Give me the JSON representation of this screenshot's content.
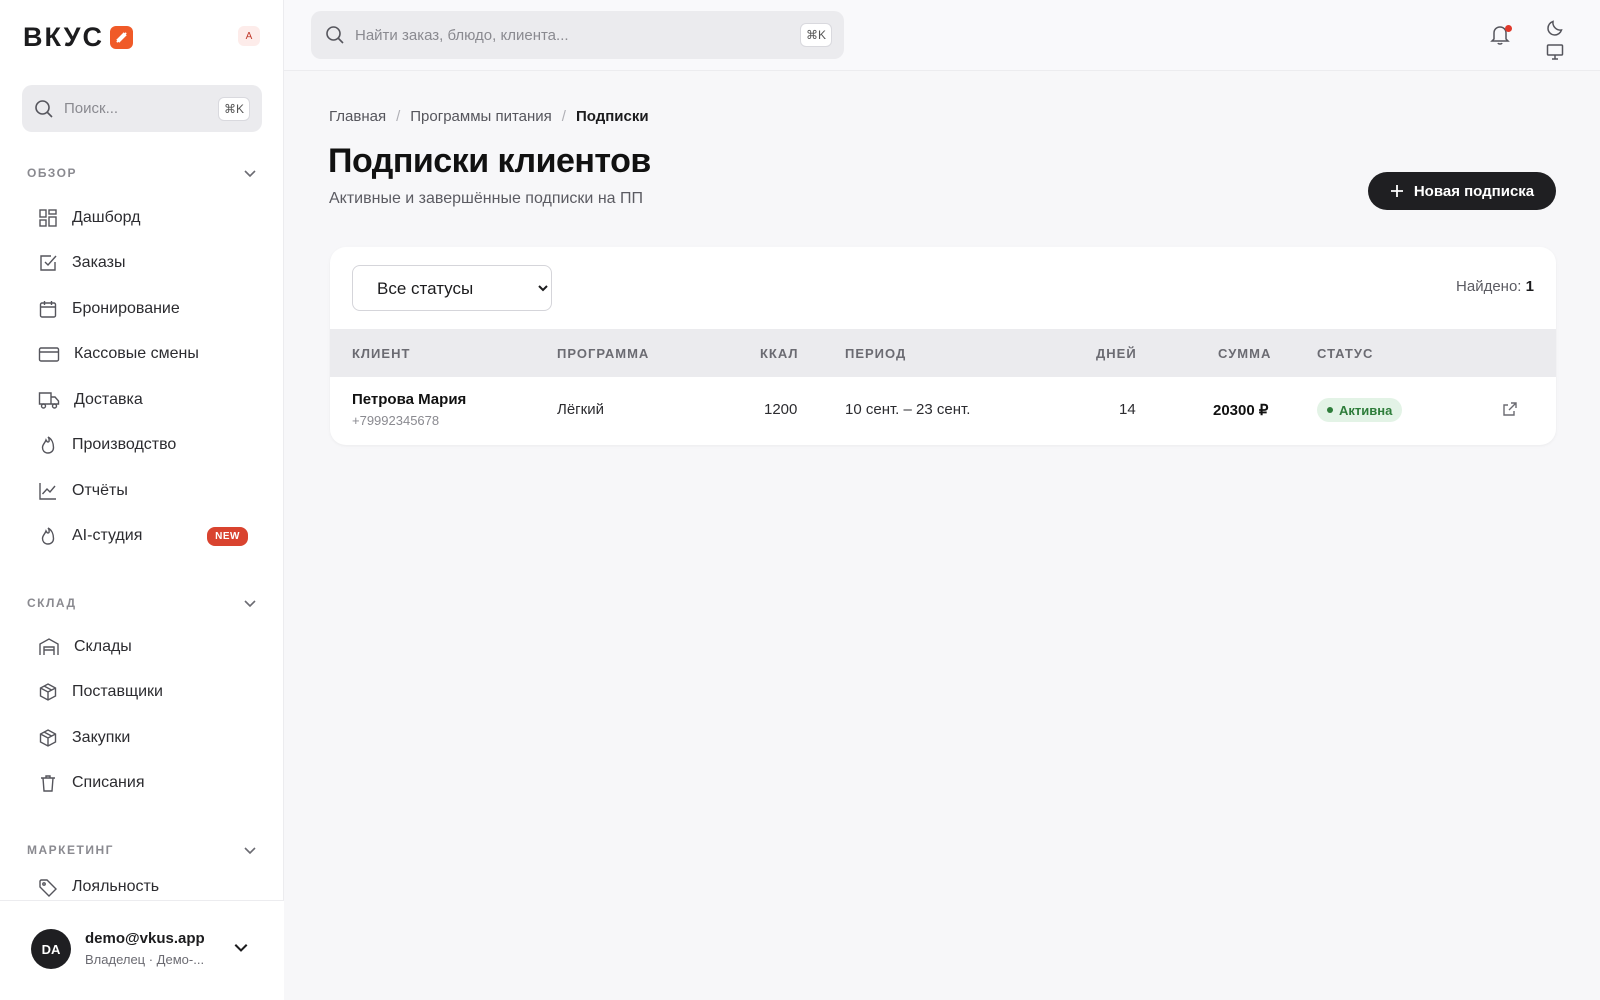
{
  "brand": {
    "name": "ВКУС",
    "badge": "A"
  },
  "sidebar": {
    "search_placeholder": "Поиск...",
    "search_shortcut": "⌘K",
    "sections": [
      {
        "title": "ОБЗОР"
      },
      {
        "title": "СКЛАД"
      },
      {
        "title": "МАРКЕТИНГ"
      }
    ],
    "items": [
      {
        "label": "Дашборд",
        "icon": "dashboard-icon"
      },
      {
        "label": "Заказы",
        "icon": "checkbox-icon"
      },
      {
        "label": "Бронирование",
        "icon": "calendar-icon"
      },
      {
        "label": "Кассовые смены",
        "icon": "card-icon"
      },
      {
        "label": "Доставка",
        "icon": "truck-icon"
      },
      {
        "label": "Производство",
        "icon": "flame-icon"
      },
      {
        "label": "Отчёты",
        "icon": "chart-icon"
      },
      {
        "label": "AI-студия",
        "icon": "flame-icon",
        "badge": "NEW"
      },
      {
        "label": "Склады",
        "icon": "warehouse-icon"
      },
      {
        "label": "Поставщики",
        "icon": "box-icon"
      },
      {
        "label": "Закупки",
        "icon": "box-icon"
      },
      {
        "label": "Списания",
        "icon": "trash-icon"
      },
      {
        "label": "Лояльность",
        "icon": "tag-icon"
      }
    ],
    "user": {
      "initials": "DA",
      "email": "demo@vkus.app",
      "role": "Владелец · Демо-..."
    }
  },
  "topbar": {
    "search_placeholder": "Найти заказ, блюдо, клиента...",
    "search_shortcut": "⌘K"
  },
  "main": {
    "breadcrumb": [
      "Главная",
      "Программы питания",
      "Подписки"
    ],
    "title": "Подписки клиентов",
    "subtitle": "Активные и завершённые подписки на ПП",
    "new_button": "Новая подписка",
    "filter": {
      "selected": "Все статусы"
    },
    "found_label": "Найдено:",
    "found_count": "1",
    "columns": [
      "КЛИЕНТ",
      "ПРОГРАММА",
      "ККАЛ",
      "ПЕРИОД",
      "ДНЕЙ",
      "СУММА",
      "СТАТУС"
    ],
    "rows": [
      {
        "client": "Петрова Мария",
        "phone": "+79992345678",
        "program": "Лёгкий",
        "kcal": "1200",
        "period": "10 сент. – 23 сент.",
        "days": "14",
        "sum": "20300 ₽",
        "status": "Активна"
      }
    ]
  },
  "colors": {
    "accent": "#f05a28",
    "dark": "#1f1f22",
    "success": "#2e7d3a",
    "danger": "#d9432f"
  }
}
